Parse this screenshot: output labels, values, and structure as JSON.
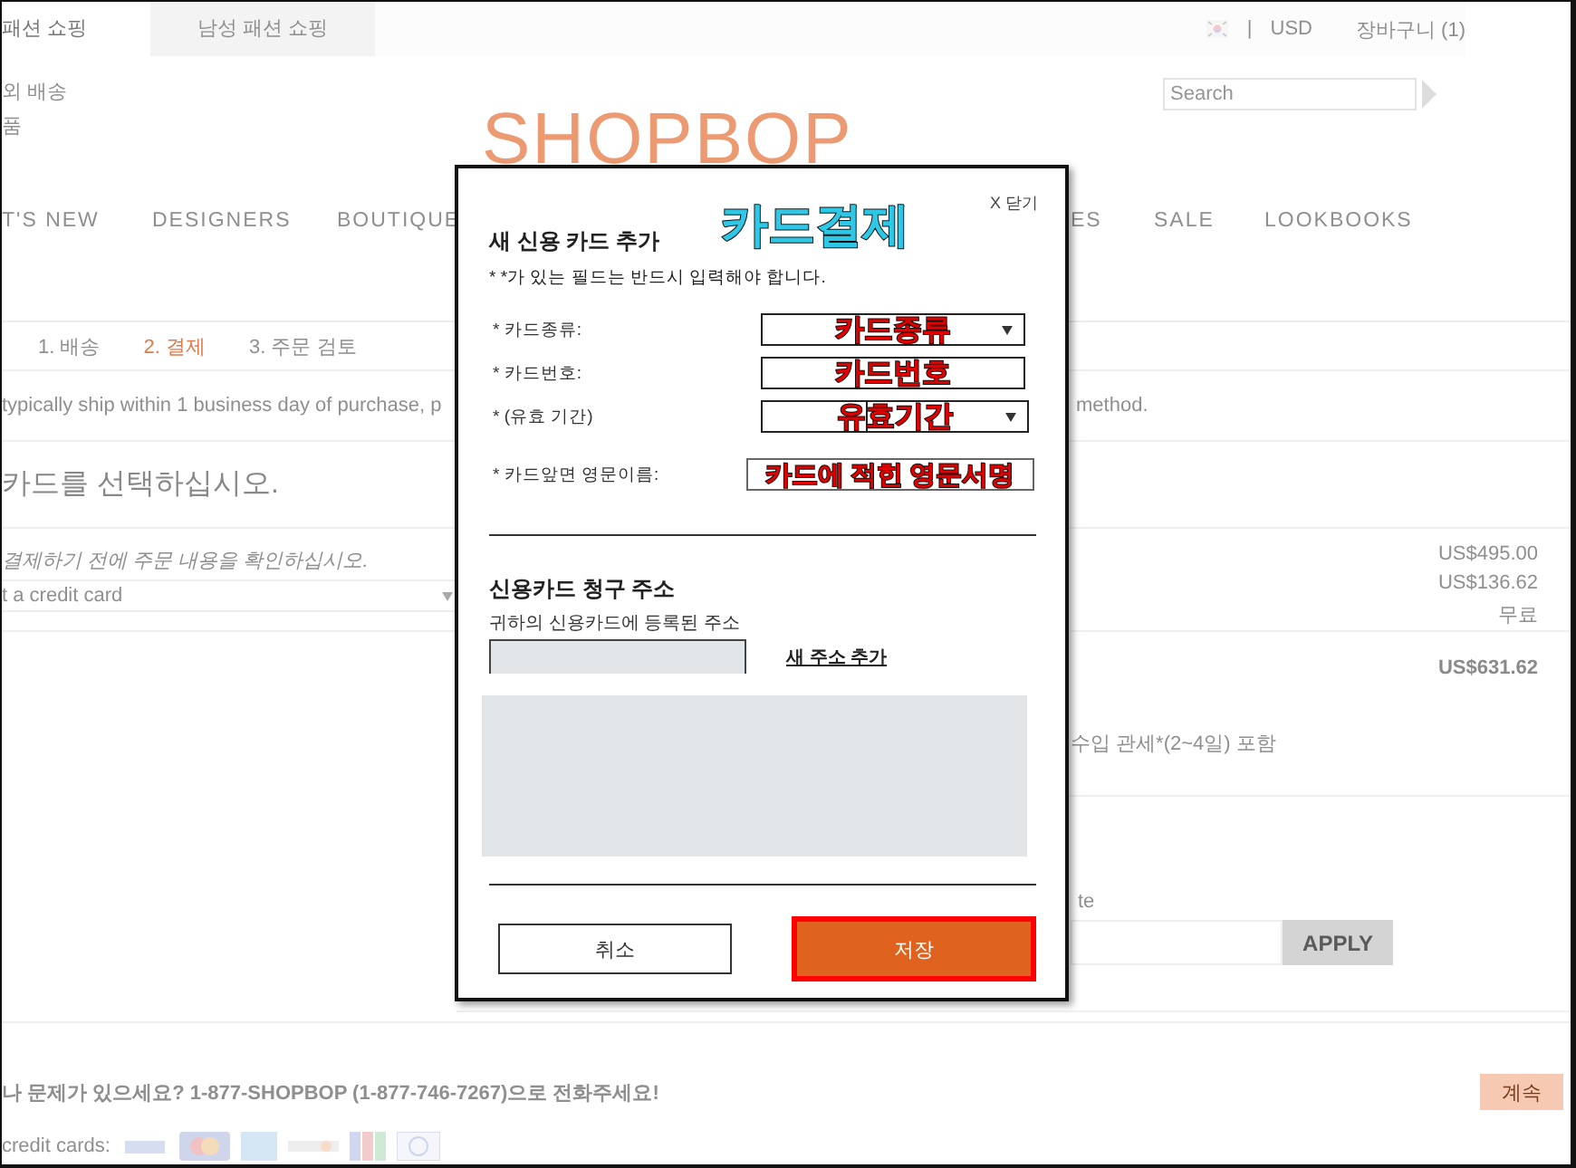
{
  "top_bar": {
    "tabs": [
      {
        "label": "패션 쇼핑",
        "selected": true
      },
      {
        "label": "남성 패션 쇼핑",
        "selected": false
      }
    ],
    "separator": "|",
    "currency": "USD",
    "cart": "장바구니 (1)"
  },
  "header": {
    "links": [
      "외 배송",
      "품"
    ],
    "logo": "SHOPBOP",
    "search": {
      "placeholder": "Search"
    }
  },
  "main_nav": [
    "T'S NEW",
    "DESIGNERS",
    "BOUTIQUE",
    "ES",
    "SALE",
    "LOOKBOOKS"
  ],
  "checkout_steps": [
    {
      "label": "1. 배송",
      "selected": false
    },
    {
      "label": "2. 결제",
      "selected": true
    },
    {
      "label": "3. 주문 검토",
      "selected": false
    }
  ],
  "shipping_notice": [
    "typically ship within 1 business day of purchase, p",
    "method."
  ],
  "payment": {
    "heading": "카드를 선택하십시오.",
    "note": "결제하기 전에 주문 내용을 확인하십시오.",
    "card_select": "t a credit card"
  },
  "summary": {
    "amounts": [
      "US$495.00",
      "US$136.62",
      "무료"
    ],
    "total": "US$631.62",
    "duties_note": "수입 관세*(2~4일) 포함",
    "promo_label": "te",
    "apply_button": "APPLY"
  },
  "footer": {
    "help_text": "나 문제가 있으세요? 1-877-SHOPBOP (1-877-746-7267)으로 전화주세요!",
    "continue_button": "계속",
    "cards_label": "credit cards:"
  },
  "modal": {
    "close": "X 닫기",
    "title": "새 신용 카드 추가",
    "title_annotation": {
      "text": "카드결제",
      "color": "#2ec8e6"
    },
    "required_note": "* *가 있는 필드는 반드시 입력해야 합니다.",
    "fields": [
      {
        "label": "* 카드종류:",
        "kind": "select",
        "annotation": {
          "text": "카드종류",
          "color": "#e00000"
        }
      },
      {
        "label": "* 카드번호:",
        "kind": "text",
        "annotation": {
          "text": "카드번호",
          "color": "#e00000"
        }
      },
      {
        "label": "* (유효 기간)",
        "kind": "date",
        "annotation": {
          "text": "유효기간",
          "color": "#e00000"
        }
      },
      {
        "label": "* 카드앞면 영문이름:",
        "kind": "text",
        "annotation": {
          "text": "카드에 적힌 영문서명",
          "color": "#e00000"
        }
      }
    ],
    "billing_title": "신용카드 청구 주소",
    "billing_note": "귀하의 신용카드에 등록된 주소",
    "add_address_link": "새 주소 추가",
    "cancel_button": "취소",
    "save_button": "저장"
  }
}
